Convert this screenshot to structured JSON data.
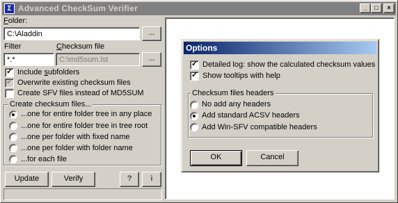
{
  "window": {
    "title": "Advanced CheckSum Verifier",
    "minimize_glyph": "_",
    "maximize_glyph": "□",
    "close_glyph": "×"
  },
  "folder": {
    "label": "Folder:",
    "label_accel": "F",
    "label_rest": "older:",
    "value": "C:\\Aladdin",
    "browse_label": "..."
  },
  "filter": {
    "label": "Filter",
    "value": "*.*"
  },
  "checksum_file": {
    "label_accel": "C",
    "label_rest": "hecksum file",
    "value": "C:\\md5sum.lst",
    "browse_label": "..."
  },
  "options": {
    "include_subfolders": {
      "pre": "Include ",
      "accel": "s",
      "post": "ubfolders",
      "checked": true
    },
    "overwrite_existing": {
      "label": "Overwrite existing checksum files",
      "checked": true,
      "disabled": true
    },
    "create_sfv": {
      "label": "Create SFV files instead of MD5SUM",
      "checked": false
    }
  },
  "create_group": {
    "title": "Create checksum files...",
    "choices": [
      {
        "label": "...one for entire folder tree in any place",
        "selected": true
      },
      {
        "label": "...one for entire folder tree in tree root",
        "selected": false
      },
      {
        "label": "...one per folder with fixed name",
        "selected": false
      },
      {
        "label": "...one per folder with folder name",
        "selected": false
      },
      {
        "label": "...for each file",
        "selected": false
      }
    ]
  },
  "buttons": {
    "update": "Update",
    "verify": "Verify",
    "help": "?",
    "info": "i"
  },
  "dialog": {
    "title": "Options",
    "detailed_log": {
      "label": "Detailed log: show the calculated checksum values",
      "checked": true
    },
    "show_tooltips": {
      "label": "Show tooltips with help",
      "checked": true
    },
    "headers_group": {
      "title": "Checksum files headers",
      "choices": [
        {
          "label": "No add any headers",
          "selected": false
        },
        {
          "label": "Add standard ACSV headers",
          "selected": true
        },
        {
          "label": "Add Win-SFV compatible headers",
          "selected": false
        }
      ]
    },
    "ok_label": "OK",
    "cancel_label": "Cancel"
  }
}
